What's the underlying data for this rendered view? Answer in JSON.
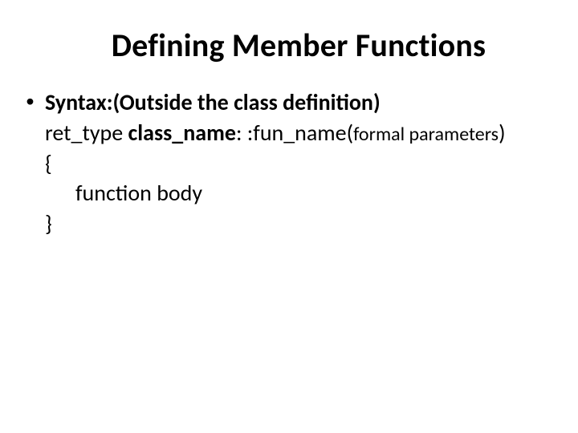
{
  "title": "Defining Member Functions",
  "bullet": {
    "dot": "•",
    "syntax_label": "Syntax:",
    "syntax_paren": "(Outside the class definition)"
  },
  "code": {
    "ret_type": "ret_type ",
    "class_name": "class_name",
    "scope_fun": ": :fun_name(",
    "formal_params": "formal parameters",
    "close_paren": ")",
    "open_brace": "{",
    "body_indent_pad": "      ",
    "body_text": "function body",
    "close_brace": "}"
  }
}
